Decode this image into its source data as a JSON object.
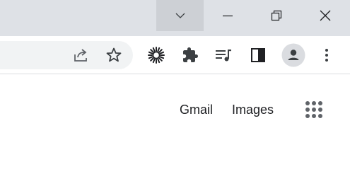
{
  "window": {
    "tab_search_icon": "chevron-down-icon",
    "minimize_icon": "minimize-icon",
    "restore_icon": "restore-icon",
    "close_icon": "close-icon"
  },
  "toolbar": {
    "omnibox_icons": [
      "share-icon",
      "star-icon"
    ],
    "extensions": [
      "sun-extension-icon",
      "puzzle-extensions-icon"
    ],
    "media_icon": "media-controls-icon",
    "side_panel_icon": "side-panel-icon",
    "profile_icon": "person-icon",
    "menu_icon": "kebab-menu-icon"
  },
  "content": {
    "gmail_label": "Gmail",
    "images_label": "Images",
    "apps_icon": "google-apps-grid-icon"
  },
  "colors": {
    "titlebar": "#dee1e6",
    "tab_search_bg": "#cdd0d5",
    "omnibox": "#f1f3f4",
    "icon": "#5f6368",
    "text": "#202124",
    "avatar_bg": "#dadce0"
  }
}
